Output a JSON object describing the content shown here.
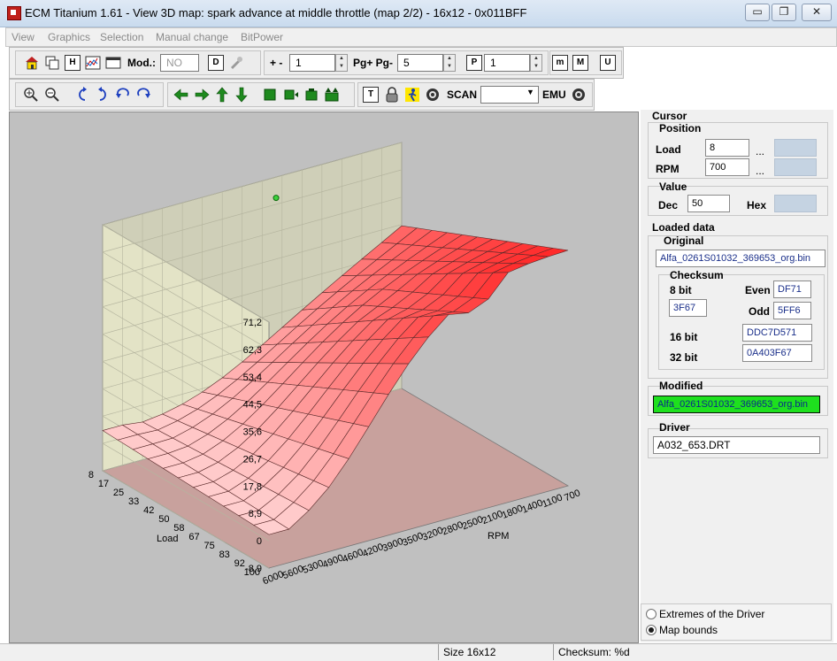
{
  "window": {
    "title": "ECM Titanium 1.61 - View 3D map: spark advance at middle throttle (map 2/2) - 16x12 - 0x011BFF",
    "minimize": "▭",
    "restore": "❐",
    "close": "✕"
  },
  "menu": [
    "View",
    "Graphics",
    "Selection",
    "Manual change",
    "BitPower"
  ],
  "toolbar1": {
    "mod_label": "Mod.:",
    "mod_value": "NO",
    "step_label": "+ -",
    "step_value": "1",
    "pg_label": "Pg+ Pg-",
    "pg_value": "5",
    "p_value": "1",
    "btn_d": "D",
    "btn_p": "P",
    "btn_m1": "m",
    "btn_m2": "M",
    "btn_u": "U",
    "btn_h": "H"
  },
  "toolbar2": {
    "scan_label": "SCAN",
    "scan_value": "",
    "emu_label": "EMU",
    "btn_t": "T"
  },
  "icons": [
    "home-icon",
    "copy-icon",
    "h-icon",
    "graph-icon",
    "window-icon",
    "d-icon",
    "gear-icon",
    "zoom-in-icon",
    "zoom-out-icon",
    "rotate-left-icon",
    "rotate-right-icon",
    "undo-icon",
    "redo-icon",
    "arrow-left-icon",
    "arrow-right-icon",
    "arrow-up-icon",
    "arrow-down-icon",
    "select-icon",
    "lock-icon",
    "walk-icon",
    "record-icon"
  ],
  "cursor": {
    "group_label": "Cursor",
    "position_label": "Position",
    "load_label": "Load",
    "load_value": "8",
    "rpm_label": "RPM",
    "rpm_value": "700",
    "dots": "...",
    "value_label": "Value",
    "dec_label": "Dec",
    "dec_value": "50",
    "hex_label": "Hex"
  },
  "loaded": {
    "group_label": "Loaded data",
    "original_label": "Original",
    "original_file": "Alfa_0261S01032_369653_org.bin",
    "checksum_label": "Checksum",
    "bit8_label": "8 bit",
    "bit8_value": "3F67",
    "even_label": "Even",
    "even_value": "DF71",
    "odd_label": "Odd",
    "odd_value": "5FF6",
    "bit16_label": "16 bit",
    "bit16_value": "DDC7D571",
    "bit32_label": "32 bit",
    "bit32_value": "0A403F67",
    "modified_label": "Modified",
    "modified_file": "Alfa_0261S01032_369653_org.bin",
    "driver_label": "Driver",
    "driver_file": "A032_653.DRT",
    "accent_modified": "#1ee01e"
  },
  "bounds": {
    "option1": "Extremes of the Driver",
    "option2": "Map bounds",
    "selected": "Map bounds"
  },
  "status": {
    "size": "Size 16x12",
    "checksum": "Checksum: %d"
  },
  "chart_data": {
    "type": "surface",
    "xlabel": "RPM",
    "ylabel": "Load",
    "z_ticks": [
      "71,2",
      "62,3",
      "53,4",
      "44,5",
      "35,6",
      "26,7",
      "17,8",
      "8,9",
      "0",
      "-8,9"
    ],
    "zlim": [
      -8.9,
      71.2
    ],
    "rpm_ticks": [
      "700",
      "1100",
      "1400",
      "1800",
      "2100",
      "2500",
      "2800",
      "3200",
      "3500",
      "3900",
      "4200",
      "4600",
      "4900",
      "5300",
      "5600",
      "6000"
    ],
    "load_ticks": [
      "8",
      "17",
      "25",
      "33",
      "42",
      "50",
      "58",
      "67",
      "75",
      "83",
      "92",
      "100"
    ],
    "surface_color": "#ff2a2a",
    "cursor_point": {
      "load": 8,
      "rpm": 700,
      "value": 50
    }
  }
}
